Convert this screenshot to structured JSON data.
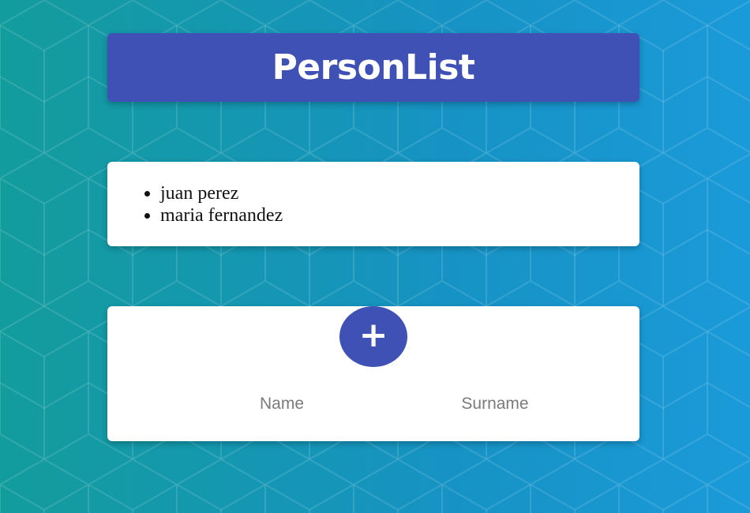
{
  "header": {
    "title": "PersonList"
  },
  "persons": [
    "juan perez",
    "maria fernandez"
  ],
  "form": {
    "add_button_icon": "plus-icon",
    "add_button_symbol": "+",
    "name_placeholder": "Name",
    "name_value": "",
    "surname_placeholder": "Surname",
    "surname_value": ""
  },
  "colors": {
    "primary": "#3f51b5",
    "background_start": "#139c9c",
    "background_end": "#1a9ad9",
    "card": "#ffffff"
  }
}
